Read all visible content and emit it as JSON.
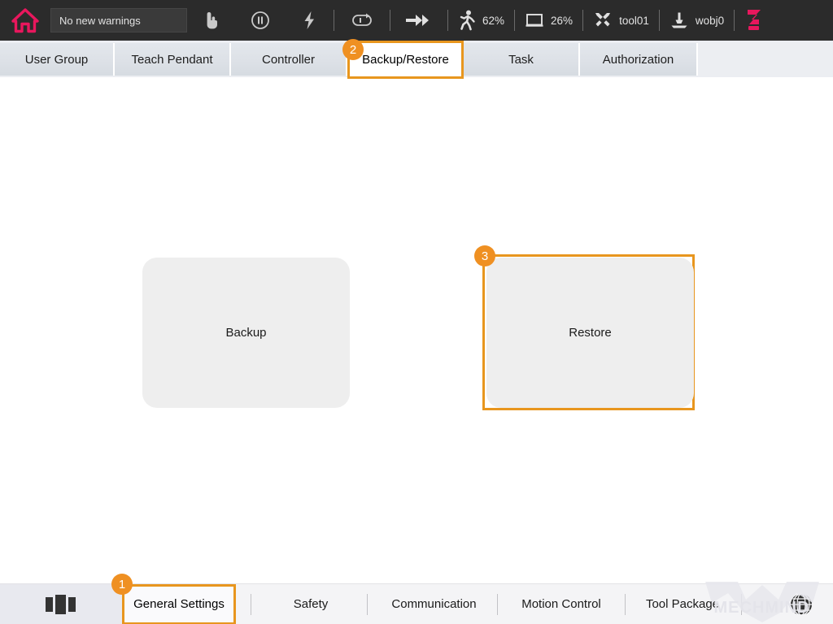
{
  "topbar": {
    "home_icon": "home-icon",
    "warning_text": "No new warnings",
    "icons": [
      {
        "name": "manual-mode-hand-icon",
        "glyph": "hand"
      },
      {
        "name": "pause-icon",
        "glyph": "pause"
      },
      {
        "name": "power-lightning-icon",
        "glyph": "bolt"
      },
      {
        "name": "loop-cycle-icon",
        "glyph": "loop"
      },
      {
        "name": "speed-forward-icon",
        "glyph": "fastforward"
      }
    ],
    "speed_override": {
      "icon": "running-person-icon",
      "value": "62%"
    },
    "screen_ratio": {
      "icon": "monitor-icon",
      "value": "26%"
    },
    "tool": {
      "icon": "tools-wrench-screwdriver-icon",
      "value": "tool01"
    },
    "workobject": {
      "icon": "workobject-icon",
      "value": "wobj0"
    },
    "robot_icon": "robot-arm-icon"
  },
  "tabs": [
    {
      "label": "User Group",
      "active": false
    },
    {
      "label": "Teach Pendant",
      "active": false
    },
    {
      "label": "Controller",
      "active": false
    },
    {
      "label": "Backup/Restore",
      "active": true
    },
    {
      "label": "Task",
      "active": false
    },
    {
      "label": "Authorization",
      "active": false
    }
  ],
  "main": {
    "backup_button": "Backup",
    "restore_button": "Restore"
  },
  "bottombar": {
    "panels_icon": "panels-layout-icon",
    "items": [
      {
        "label": "General Settings",
        "active": true
      },
      {
        "label": "Safety",
        "active": false
      },
      {
        "label": "Communication",
        "active": false
      },
      {
        "label": "Motion Control",
        "active": false
      },
      {
        "label": "Tool Package",
        "active": false
      }
    ],
    "globe_icon": "globe-language-icon",
    "watermark": "MECHMIND"
  },
  "badges": [
    {
      "number": "1",
      "target": "general-settings-bottom-item"
    },
    {
      "number": "2",
      "target": "backup-restore-tab"
    },
    {
      "number": "3",
      "target": "restore-button"
    }
  ],
  "colors": {
    "accent_orange": "#e8961e",
    "badge_orange": "#ef9022",
    "topbar_bg": "#2b2b2b",
    "tabstrip_bg": "#eceef2",
    "button_bg": "#eeeeee",
    "brand_crimson": "#e8175d"
  }
}
